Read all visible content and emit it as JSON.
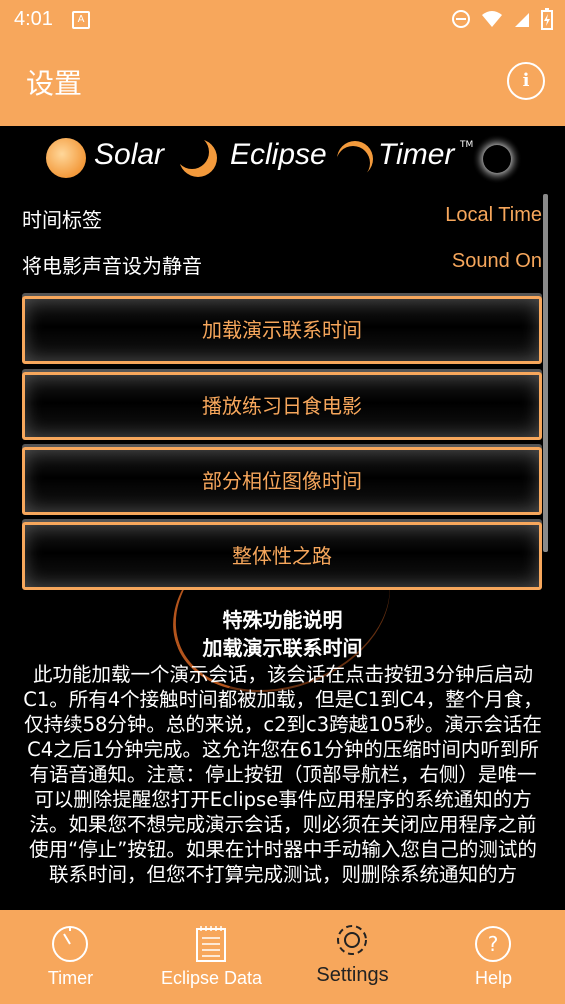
{
  "status_bar": {
    "time": "4:01",
    "notification_icon": "A"
  },
  "app_bar": {
    "title": "设置",
    "info_icon": "i"
  },
  "logo": {
    "word1": "Solar",
    "word2": "Eclipse",
    "word3": "Timer",
    "trademark": "TM"
  },
  "settings": [
    {
      "label": "时间标签",
      "value": "Local Time"
    },
    {
      "label": "将电影声音设为静音",
      "value": "Sound On"
    }
  ],
  "buttons": [
    {
      "label": "加载演示联系时间"
    },
    {
      "label": "播放练习日食电影"
    },
    {
      "label": "部分相位图像时间"
    },
    {
      "label": "整体性之路"
    }
  ],
  "description": {
    "heading": "特殊功能说明",
    "subheading": "加载演示联系时间",
    "body": "此功能加载一个演示会话，该会话在点击按钮3分钟后启动C1。所有4个接触时间都被加载，但是C1到C4，整个月食，仅持续58分钟。总的来说，c2到c3跨越105秒。演示会话在C4之后1分钟完成。这允许您在61分钟的压缩时间内听到所有语音通知。注意：停止按钮（顶部导航栏，右侧）是唯一可以删除提醒您打开Eclipse事件应用程序的系统通知的方法。如果您不想完成演示会话，则必须在关闭应用程序之前使用“停止”按钮。如果在计时器中手动输入您自己的测试的联系时间，但您不打算完成测试，则删除系统通知的方"
  },
  "bottom_nav": [
    {
      "label": "Timer",
      "icon": "stopwatch-icon"
    },
    {
      "label": "Eclipse Data",
      "icon": "notepad-icon"
    },
    {
      "label": "Settings",
      "icon": "gear-icon"
    },
    {
      "label": "Help",
      "icon": "help-icon"
    }
  ],
  "colors": {
    "accent": "#F7A75C",
    "background": "#000000",
    "text": "#FFFFFF"
  }
}
